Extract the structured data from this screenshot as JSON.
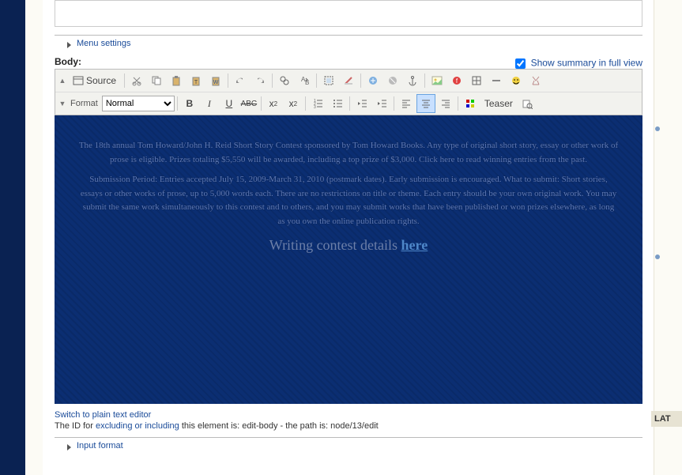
{
  "fieldsets": {
    "menu_settings": "Menu settings",
    "input_format": "Input format"
  },
  "body_label": "Body:",
  "show_summary_label": "Show summary in full view",
  "show_summary_checked": true,
  "toolbar": {
    "source_label": "Source",
    "format_label": "Format",
    "format_value": "Normal",
    "teaser_label": "Teaser"
  },
  "editor_content": {
    "p1": "The 18th annual Tom Howard/John H. Reid Short Story Contest sponsored by Tom Howard Books. Any type of original short story, essay or other work of prose is eligible. Prizes totaling $5,550 will be awarded, including a top prize of $3,000. Click here to read winning entries from the past.",
    "p2": "Submission Period: Entries accepted July 15, 2009-March 31, 2010 (postmark dates). Early submission is encouraged. What to submit: Short stories, essays or other works of prose, up to 5,000 words each. There are no restrictions on title or theme. Each entry should be your own original work. You may submit the same work simultaneously to this contest and to others, and you may submit works that have been published or won prizes elsewhere, as long as you own the online publication rights.",
    "p3_text": "Writing contest details ",
    "p3_link": "here"
  },
  "switch_link": "Switch to plain text editor",
  "id_line": {
    "prefix": "The ID for ",
    "link": "excluding or including",
    "suffix": " this element is: edit-body - the path is: node/13/edit"
  },
  "sidebar": {
    "latest_heading": "LAT"
  }
}
